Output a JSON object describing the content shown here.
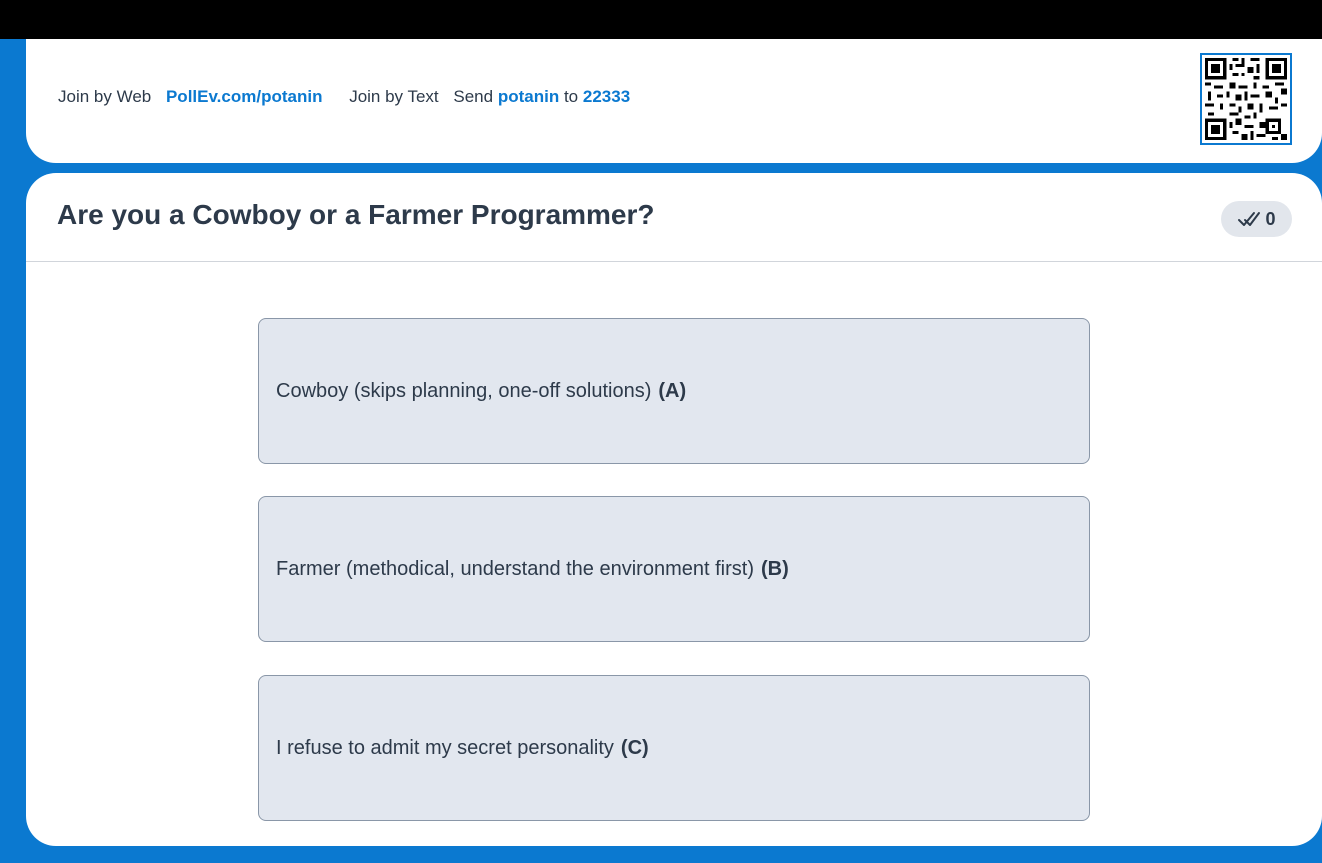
{
  "join": {
    "web_label": "Join by Web",
    "web_url": "PollEv.com/potanin",
    "text_label": "Join by Text",
    "send_label": "Send",
    "keyword": "potanin",
    "to_label": "to",
    "number": "22333"
  },
  "poll": {
    "title": "Are you a Cowboy or a Farmer Programmer?",
    "response_count": "0",
    "options": [
      {
        "text": "Cowboy (skips planning, one-off solutions)",
        "letter": "(A)"
      },
      {
        "text": "Farmer (methodical, understand the environment first)",
        "letter": "(B)"
      },
      {
        "text": "I refuse to admit my secret personality",
        "letter": "(C)"
      }
    ]
  },
  "colors": {
    "brand_blue": "#0b79d0",
    "text_dark": "#2d3a4a",
    "option_bg": "#e2e7ef"
  },
  "icons": {
    "qr": "qr-code-icon",
    "responses": "double-check-icon"
  }
}
